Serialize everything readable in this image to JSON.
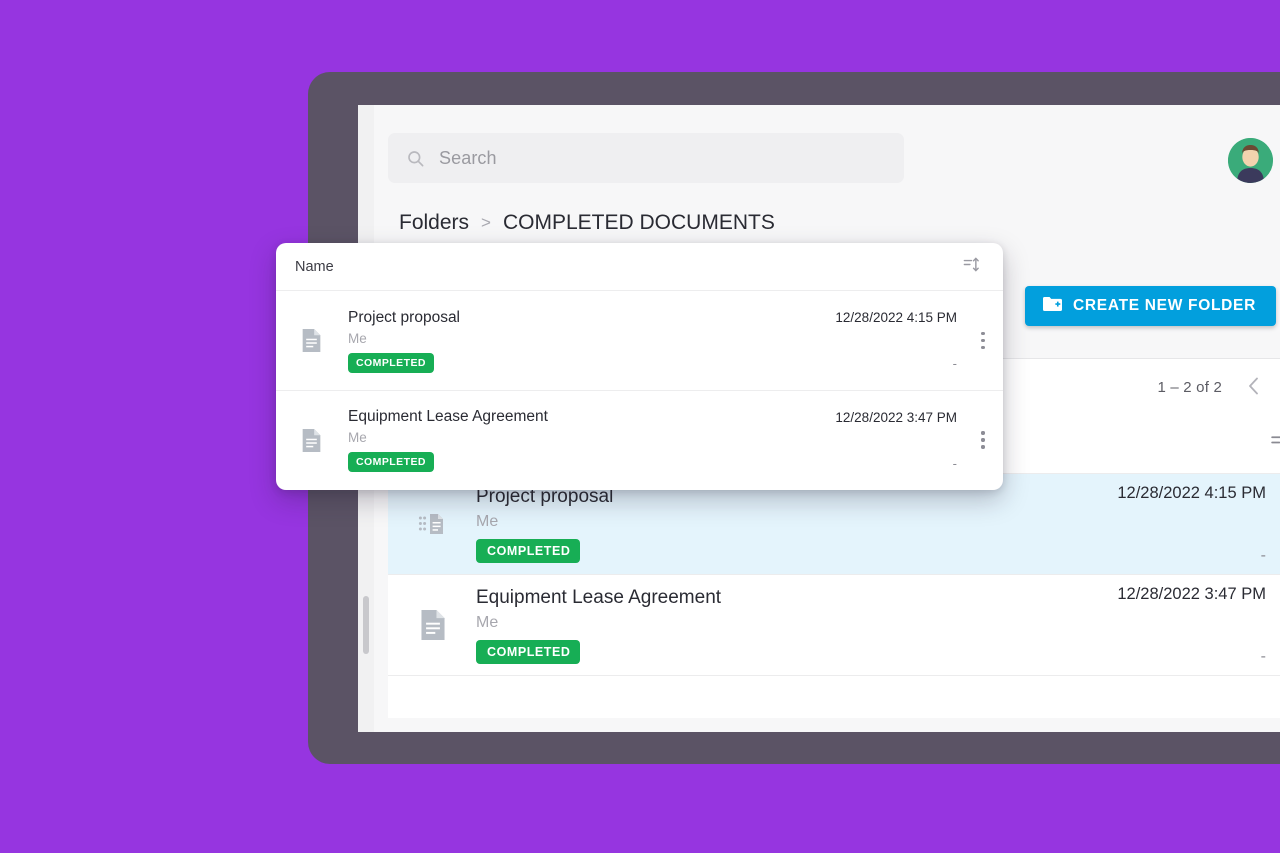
{
  "theme": {
    "background_purple": "#9635e0",
    "device_frame": "#5b5365",
    "app_canvas": "#f7f7f8",
    "accent_blue": "#029fdd",
    "badge_green": "#17ae55",
    "drop_highlight_blue": "#e4f4fc"
  },
  "search": {
    "placeholder": "Search",
    "value": "",
    "icon": "search-icon"
  },
  "avatar": {
    "icon": "user-avatar"
  },
  "breadcrumb": {
    "root": "Folders",
    "separator": ">",
    "current": "COMPLETED DOCUMENTS"
  },
  "toolbar": {
    "create_folder_label": "CREATE NEW FOLDER",
    "create_folder_icon": "folder-plus-icon"
  },
  "pagination": {
    "range_label": "1 – 2 of 2",
    "prev_icon": "chevron-left-icon",
    "next_icon": "chevron-right-icon"
  },
  "table": {
    "sort_icon": "sort-icon",
    "column_name": "Name",
    "rows": [
      {
        "title": "Project proposal",
        "owner": "Me",
        "status": "COMPLETED",
        "date": "12/28/2022 4:15 PM",
        "extra": "-",
        "icon": "document-drag-icon",
        "highlighted": true
      },
      {
        "title": "Equipment Lease Agreement",
        "owner": "Me",
        "status": "COMPLETED",
        "date": "12/28/2022 3:47 PM",
        "extra": "-",
        "icon": "document-icon",
        "highlighted": false
      }
    ]
  },
  "drag_card": {
    "column_name": "Name",
    "sort_icon": "sort-icon",
    "rows": [
      {
        "title": "Project proposal",
        "owner": "Me",
        "status": "COMPLETED",
        "date": "12/28/2022 4:15 PM",
        "extra": "-",
        "icon": "document-icon"
      },
      {
        "title": "Equipment Lease Agreement",
        "owner": "Me",
        "status": "COMPLETED",
        "date": "12/28/2022 3:47 PM",
        "extra": "-",
        "icon": "document-icon"
      }
    ]
  }
}
